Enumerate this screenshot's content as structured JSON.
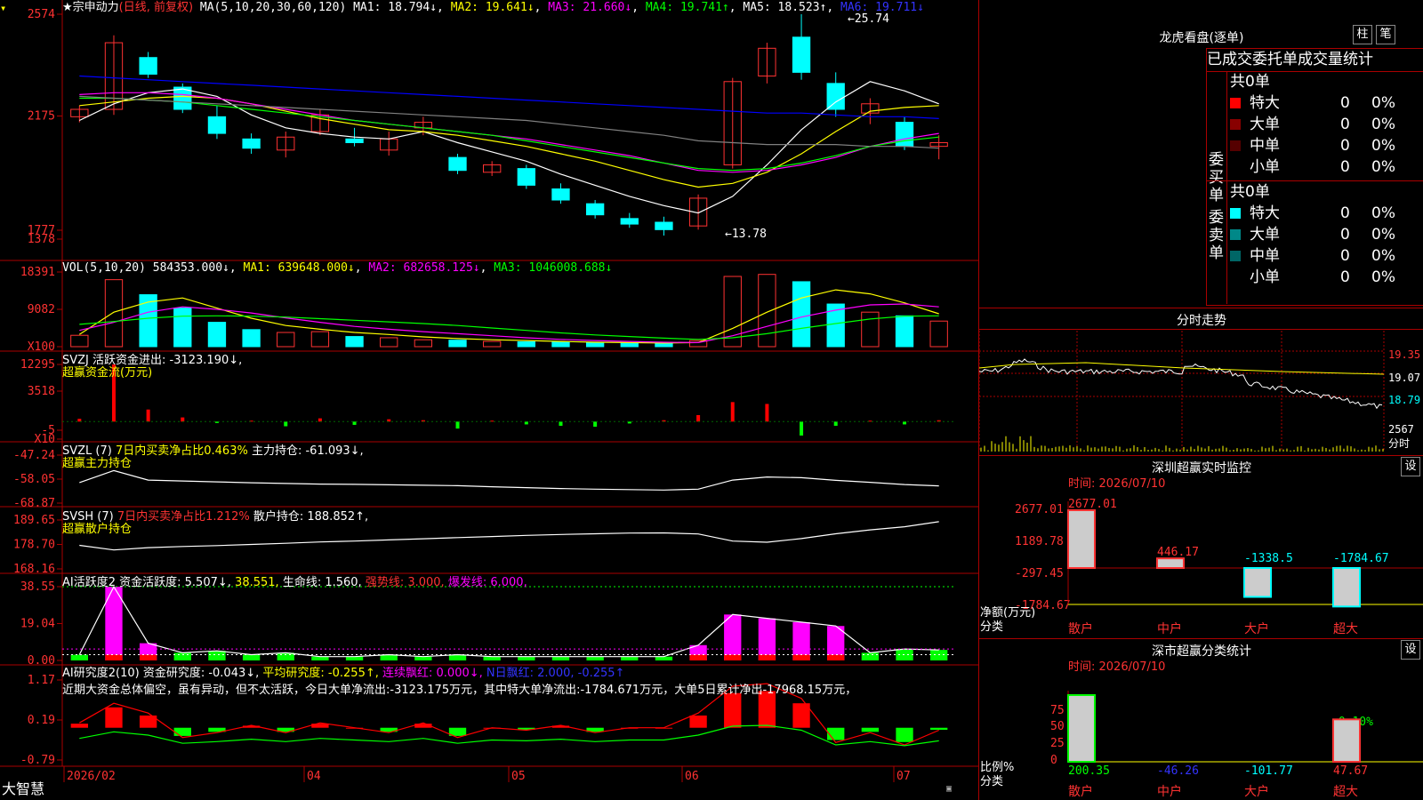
{
  "app": {
    "brand": "大智慧",
    "stock_name": "宗申动力",
    "mode": "(日线, 前复权)"
  },
  "colors": {
    "up": "#ff3232",
    "down": "#00ffff",
    "ma1": "#ffffff",
    "ma2": "#ffff00",
    "ma3": "#ff00ff",
    "ma4": "#00ff00",
    "ma5": "#808080",
    "ma6": "#0000ff",
    "label": "#ff3232"
  },
  "price_pane": {
    "header": {
      "name": "★宗申动力",
      "mode": "(日线, 前复权)",
      "ma_def": "MA(5,10,20,30,60,120)",
      "ma1": "MA1: 18.794↓",
      "ma2": "MA2: 19.641↓",
      "ma3": "MA3: 21.660↓",
      "ma4": "MA4: 19.741↑",
      "ma5": "MA5: 18.523↑",
      "ma6": "MA6: 19.711↓"
    },
    "yticks": [
      "2574",
      "2175",
      "1777",
      "1378"
    ],
    "hi_label": "←25.74",
    "lo_label": "←13.78"
  },
  "vol_pane": {
    "header": {
      "name": "VOL(5,10,20)",
      "val": "584353.000↓",
      "ma1": "MA1: 639648.000↓",
      "ma2": "MA2: 682658.125↓",
      "ma3": "MA3: 1046008.688↓"
    },
    "yticks": [
      "18391",
      "9082",
      "X100"
    ]
  },
  "svzj_pane": {
    "header1": "SVZJ  活跃资金进出: -3123.190↓,",
    "header2": "超赢资金流(万元)",
    "yticks": [
      "12295",
      "3518",
      "-5",
      "X10"
    ]
  },
  "svzl_pane": {
    "h_name": "SVZL (7)",
    "h_ratio": "7日内买卖净占比0.463%",
    "h_val": "主力持仓: -61.093↓,",
    "header2": "超赢主力持仓",
    "yticks": [
      "-47.24",
      "-58.05",
      "-68.87"
    ]
  },
  "svsh_pane": {
    "h_name": "SVSH (7)",
    "h_ratio": "7日内买卖净占比1.212%",
    "h_val": "散户持仓: 188.852↑,",
    "header2": "超赢散户持仓",
    "yticks": [
      "189.65",
      "178.70",
      "168.16"
    ]
  },
  "ai_pane": {
    "h_name": "AI活跃度2",
    "h_val": "资金活跃度: 5.507↓,",
    "h_38": "38.551,",
    "h_life": "生命线: 1.560,",
    "h_strong": "强势线: 3.000,",
    "h_burst": "爆发线: 6.000,",
    "yticks": [
      "38.55",
      "19.04",
      "0.00"
    ]
  },
  "air_pane": {
    "h_name": "AI研究度2(10)",
    "h_val": "资金研究度: -0.043↓,",
    "h_avg": "平均研究度: -0.255↑,",
    "h_lx": "连续飘红: 0.000↓,",
    "h_n": "N日飘红: 2.000, -0.255↑",
    "comment": "近期大资金总体偏空，虽有异动，但不太活跃，今日大单净流出:-3123.175万元，其中特大单净流出:-1784.671万元，大单5日累计净出-17968.15万元，",
    "yticks": [
      "1.17",
      "0.19",
      "-0.79"
    ]
  },
  "date_axis": [
    "2026/02",
    "04",
    "05",
    "06",
    "07"
  ],
  "chart_data": [
    {
      "type": "candlestick",
      "title": "宗申动力 (日线, 前复权)",
      "ylim": [
        13.0,
        26.0
      ],
      "x": [
        "2026/02",
        "",
        "",
        "",
        "",
        "",
        "",
        "",
        "",
        "",
        "",
        "",
        "",
        "",
        "",
        "",
        "",
        "",
        "",
        "",
        "",
        "",
        "",
        "",
        "",
        ""
      ],
      "ohlc": [
        [
          20.2,
          20.8,
          19.9,
          20.6
        ],
        [
          20.6,
          24.6,
          20.3,
          24.2
        ],
        [
          23.4,
          23.7,
          22.3,
          22.5
        ],
        [
          21.8,
          22.0,
          20.4,
          20.6
        ],
        [
          20.2,
          20.8,
          19.0,
          19.3
        ],
        [
          19.0,
          19.3,
          18.2,
          18.5
        ],
        [
          18.4,
          19.4,
          18.0,
          19.1
        ],
        [
          19.4,
          20.6,
          19.2,
          20.3
        ],
        [
          19.0,
          19.6,
          18.6,
          18.8
        ],
        [
          18.4,
          19.4,
          18.1,
          19.0
        ],
        [
          19.6,
          20.2,
          19.2,
          19.9
        ],
        [
          18.0,
          18.2,
          17.1,
          17.3
        ],
        [
          17.2,
          17.8,
          17.0,
          17.6
        ],
        [
          17.4,
          17.6,
          16.3,
          16.5
        ],
        [
          16.3,
          16.6,
          15.5,
          15.7
        ],
        [
          15.5,
          15.7,
          14.7,
          14.9
        ],
        [
          14.7,
          15.0,
          14.2,
          14.4
        ],
        [
          14.5,
          14.8,
          13.78,
          14.1
        ],
        [
          14.3,
          16.0,
          14.1,
          15.8
        ],
        [
          17.6,
          22.3,
          17.4,
          22.1
        ],
        [
          22.4,
          24.2,
          22.0,
          23.9
        ],
        [
          24.5,
          25.74,
          22.2,
          22.6
        ],
        [
          22.0,
          22.6,
          20.2,
          20.6
        ],
        [
          20.4,
          21.2,
          19.8,
          20.9
        ],
        [
          19.9,
          20.2,
          18.4,
          18.6
        ],
        [
          18.6,
          19.2,
          17.9,
          18.8
        ]
      ],
      "series": [
        {
          "name": "MA1",
          "values": [
            20.0,
            20.9,
            21.5,
            21.7,
            21.3,
            20.3,
            19.6,
            19.3,
            19.1,
            19.0,
            19.4,
            18.8,
            18.3,
            17.8,
            17.1,
            16.5,
            15.9,
            15.4,
            15.0,
            15.9,
            17.6,
            19.5,
            21.0,
            22.1,
            21.6,
            20.9
          ]
        },
        {
          "name": "MA2",
          "values": [
            20.8,
            21.0,
            21.2,
            21.3,
            21.2,
            20.9,
            20.5,
            20.1,
            19.8,
            19.5,
            19.4,
            19.2,
            18.9,
            18.6,
            18.2,
            17.8,
            17.3,
            16.8,
            16.4,
            16.6,
            17.2,
            18.2,
            19.4,
            20.5,
            20.7,
            20.8
          ]
        },
        {
          "name": "MA3",
          "values": [
            21.4,
            21.5,
            21.5,
            21.4,
            21.2,
            20.9,
            20.6,
            20.3,
            20.0,
            19.8,
            19.6,
            19.4,
            19.2,
            19.0,
            18.7,
            18.4,
            18.1,
            17.7,
            17.3,
            17.2,
            17.3,
            17.6,
            18.0,
            18.6,
            19.0,
            19.3
          ]
        },
        {
          "name": "MA4",
          "values": [
            21.2,
            21.2,
            21.1,
            21.0,
            20.8,
            20.6,
            20.4,
            20.2,
            20.0,
            19.8,
            19.6,
            19.4,
            19.2,
            18.9,
            18.6,
            18.3,
            18.0,
            17.7,
            17.4,
            17.3,
            17.4,
            17.7,
            18.1,
            18.6,
            18.9,
            19.1
          ]
        },
        {
          "name": "MA5",
          "values": [
            21.3,
            21.2,
            21.1,
            21.0,
            20.9,
            20.8,
            20.7,
            20.6,
            20.5,
            20.4,
            20.3,
            20.2,
            20.1,
            20.0,
            19.8,
            19.6,
            19.4,
            19.2,
            18.9,
            18.8,
            18.7,
            18.7,
            18.7,
            18.6,
            18.6,
            18.5
          ]
        },
        {
          "name": "MA6",
          "values": [
            22.4,
            22.3,
            22.2,
            22.1,
            22.0,
            21.9,
            21.8,
            21.7,
            21.6,
            21.5,
            21.4,
            21.3,
            21.2,
            21.1,
            21.0,
            20.9,
            20.8,
            20.7,
            20.6,
            20.5,
            20.4,
            20.4,
            20.3,
            20.2,
            20.2,
            20.1
          ]
        }
      ]
    },
    {
      "type": "bar",
      "title": "VOL(5,10,20)",
      "ylim": [
        0,
        18391
      ],
      "values": [
        2800,
        16500,
        12800,
        9500,
        6000,
        4200,
        3500,
        3700,
        2500,
        2200,
        1700,
        1600,
        1300,
        1200,
        1100,
        1000,
        900,
        800,
        1500,
        17300,
        17800,
        16000,
        10500,
        8500,
        7600,
        6300
      ],
      "series": [
        {
          "name": "MA1",
          "values": [
            3000,
            8500,
            11000,
            12000,
            9500,
            7000,
            5200,
            4300,
            3500,
            3000,
            2400,
            2000,
            1700,
            1500,
            1300,
            1100,
            1000,
            900,
            1000,
            4500,
            8500,
            12000,
            14000,
            13000,
            10800,
            8100
          ]
        },
        {
          "name": "MA2",
          "values": [
            4000,
            6000,
            8500,
            9800,
            9200,
            8300,
            7100,
            6000,
            5000,
            4300,
            3700,
            3200,
            2700,
            2200,
            1800,
            1500,
            1300,
            1100,
            1000,
            2700,
            5000,
            7300,
            9000,
            10300,
            10500,
            9800
          ]
        },
        {
          "name": "MA3",
          "values": [
            5500,
            6200,
            7000,
            7500,
            7600,
            7500,
            7300,
            6900,
            6500,
            6100,
            5700,
            5200,
            4600,
            4000,
            3400,
            2900,
            2500,
            2100,
            1800,
            2200,
            3200,
            4500,
            5700,
            6800,
            7500,
            7600
          ]
        }
      ]
    },
    {
      "type": "bar",
      "title": "超赢资金流(万元)",
      "ylim": [
        -5,
        12295
      ],
      "values": [
        600,
        12295,
        2600,
        900,
        -300,
        200,
        -1000,
        700,
        -700,
        500,
        300,
        -1500,
        200,
        -600,
        -900,
        -1100,
        -400,
        300,
        1400,
        4200,
        3800,
        -3000,
        -900,
        200,
        -600,
        300
      ]
    },
    {
      "type": "line",
      "title": "超赢主力持仓",
      "ylim": [
        -68.87,
        -47.24
      ],
      "values": [
        -59.6,
        -54.2,
        -58.5,
        -58.9,
        -59.3,
        -59.7,
        -60.0,
        -60.3,
        -60.4,
        -60.6,
        -60.8,
        -61.0,
        -61.5,
        -61.9,
        -62.3,
        -62.6,
        -62.8,
        -63.0,
        -62.6,
        -58.5,
        -57.1,
        -57.4,
        -58.6,
        -59.5,
        -60.5,
        -61.1
      ]
    },
    {
      "type": "line",
      "title": "超赢散户持仓",
      "ylim": [
        168.16,
        189.65
      ],
      "values": [
        178.5,
        176.5,
        177.5,
        178.0,
        178.4,
        178.9,
        179.4,
        180.0,
        180.4,
        180.9,
        181.4,
        181.9,
        182.4,
        182.9,
        183.3,
        183.6,
        183.9,
        184.0,
        183.5,
        180.4,
        179.9,
        181.5,
        183.6,
        185.3,
        186.7,
        188.9
      ]
    },
    {
      "type": "bar",
      "title": "AI活跃度2",
      "ylim": [
        0,
        38.55
      ],
      "values": [
        3,
        38.5,
        9,
        4,
        5,
        3,
        4,
        2,
        2,
        3,
        2,
        3,
        2,
        2,
        2,
        2,
        2,
        2,
        8,
        24,
        22,
        20,
        18,
        4,
        6,
        5.5
      ]
    },
    {
      "type": "bar",
      "title": "AI研究度2(10)",
      "ylim": [
        -0.79,
        1.17
      ],
      "values": [
        0.1,
        0.5,
        0.3,
        -0.2,
        -0.1,
        0.05,
        -0.1,
        0.1,
        0.0,
        -0.1,
        0.1,
        -0.2,
        0.0,
        -0.05,
        0.05,
        -0.1,
        0.0,
        0.0,
        0.3,
        0.85,
        0.9,
        0.6,
        -0.3,
        -0.1,
        -0.35,
        -0.05
      ]
    }
  ],
  "right_panel": {
    "dragon_title": "龙虎看盘(逐单)",
    "btn_col": "柱",
    "btn_pen": "笔",
    "table_title": "已成交委托单成交量统计",
    "buy_label": "委买单",
    "sell_label": "委卖单",
    "buy_total": "共0单",
    "sell_total": "共0单",
    "buy_rows": [
      {
        "label": "特大",
        "val": "0",
        "pct": "0%",
        "color": "#ff0000"
      },
      {
        "label": "大单",
        "val": "0",
        "pct": "0%",
        "color": "#880000"
      },
      {
        "label": "中单",
        "val": "0",
        "pct": "0%",
        "color": "#550000"
      },
      {
        "label": "小单",
        "val": "0",
        "pct": "0%",
        "color": ""
      }
    ],
    "sell_rows": [
      {
        "label": "特大",
        "val": "0",
        "pct": "0%",
        "color": "#00ffff"
      },
      {
        "label": "大单",
        "val": "0",
        "pct": "0%",
        "color": "#008888"
      },
      {
        "label": "中单",
        "val": "0",
        "pct": "0%",
        "color": "#006666"
      },
      {
        "label": "小单",
        "val": "0",
        "pct": "0%",
        "color": ""
      }
    ],
    "minute_title": "分时走势",
    "minute_ticks": [
      "19.35",
      "19.07",
      "18.79",
      "2567",
      "分时"
    ],
    "sz_title": "深圳超赢实时监控",
    "sz_btn": "设",
    "sz_time": "时间: 2026/07/10",
    "sz_yticks": [
      "2677.01",
      "1189.78",
      "-297.45",
      "-1784.67"
    ],
    "sz_ylabel1": "净额(万元)",
    "sz_ylabel2": "分类",
    "sz_cats": [
      "散户",
      "中户",
      "大户",
      "超大"
    ],
    "sz_vals": [
      "2677.01",
      "446.17",
      "-1338.5",
      "-1784.67"
    ],
    "cls_title": "深市超赢分类统计",
    "cls_btn": "设",
    "cls_time": "时间: 2026/07/10",
    "cls_yticks": [
      "75",
      "50",
      "25",
      "0"
    ],
    "cls_ylabel1": "比例%",
    "cls_ylabel2": "分类",
    "cls_cats": [
      "散户",
      "中户",
      "大户",
      "超大"
    ],
    "cls_vals": [
      "200.35",
      "-46.26",
      "-101.77",
      "47.67"
    ],
    "cls_top": "-0.10%"
  },
  "chart_data_panels": [
    {
      "type": "bar",
      "title": "深圳超赢实时监控",
      "categories": [
        "散户",
        "中户",
        "大户",
        "超大"
      ],
      "values": [
        2677.01,
        446.17,
        -1338.5,
        -1784.67
      ],
      "ylim": [
        -1784.67,
        2677.01
      ]
    },
    {
      "type": "bar",
      "title": "深市超赢分类统计",
      "categories": [
        "散户",
        "中户",
        "大户",
        "超大"
      ],
      "values": [
        200.35,
        -46.26,
        -101.77,
        47.67
      ],
      "ylim": [
        0,
        75
      ]
    }
  ]
}
